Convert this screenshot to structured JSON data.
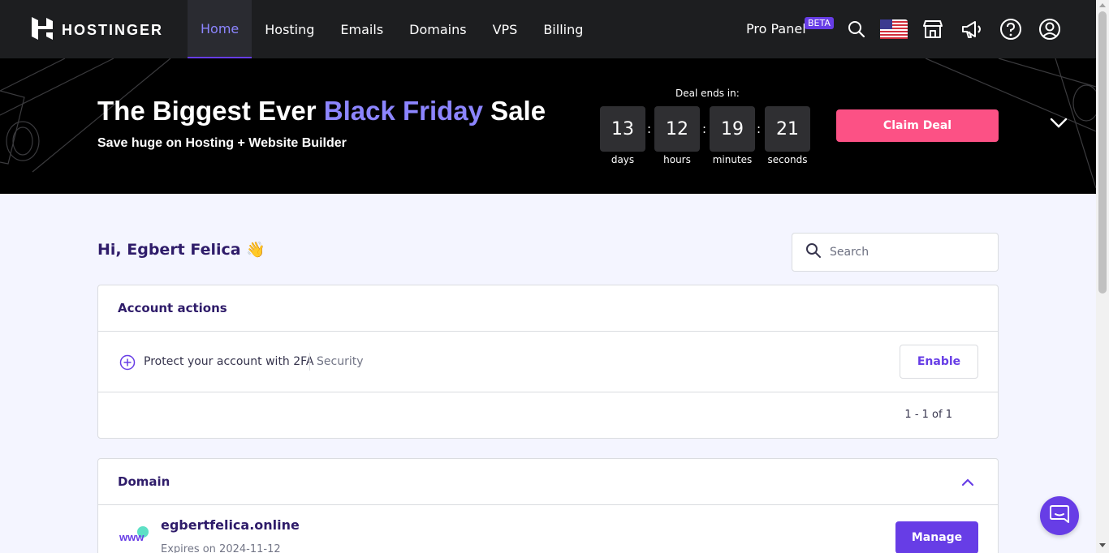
{
  "brand": {
    "name": "HOSTINGER"
  },
  "nav": {
    "items": [
      {
        "label": "Home",
        "active": true
      },
      {
        "label": "Hosting"
      },
      {
        "label": "Emails"
      },
      {
        "label": "Domains"
      },
      {
        "label": "VPS"
      },
      {
        "label": "Billing"
      }
    ],
    "pro_panel": "Pro Panel",
    "beta": "BETA",
    "icons": [
      "search-icon",
      "us-flag-icon",
      "store-icon",
      "megaphone-icon",
      "help-icon",
      "account-icon"
    ]
  },
  "banner": {
    "title_start": "The Biggest Ever ",
    "title_highlight": "Black Friday",
    "title_end": " Sale",
    "subtitle": "Save huge on Hosting + Website Builder",
    "deal_ends": "Deal ends in:",
    "countdown": [
      {
        "value": "13",
        "label": "days"
      },
      {
        "value": "12",
        "label": "hours"
      },
      {
        "value": "19",
        "label": "minutes"
      },
      {
        "value": "21",
        "label": "seconds"
      }
    ],
    "separator": ":",
    "cta": "Claim Deal",
    "accent": "#8c85ff",
    "cta_color": "#fc5185"
  },
  "main": {
    "greeting": "Hi, Egbert Felica",
    "greeting_emoji": "👋",
    "search": {
      "placeholder": "Search",
      "value": ""
    }
  },
  "account_actions": {
    "title": "Account actions",
    "rows": [
      {
        "text": "Protect your account with 2FA",
        "tag": "Security",
        "button": "Enable"
      }
    ],
    "pagination": "1 - 1 of 1"
  },
  "domain": {
    "title": "Domain",
    "items": [
      {
        "name": "egbertfelica.online",
        "expires": "Expires on 2024-11-12",
        "button": "Manage"
      }
    ]
  },
  "colors": {
    "primary": "#673de6",
    "topbar": "#1d1e20",
    "text": "#2f1c6a"
  }
}
